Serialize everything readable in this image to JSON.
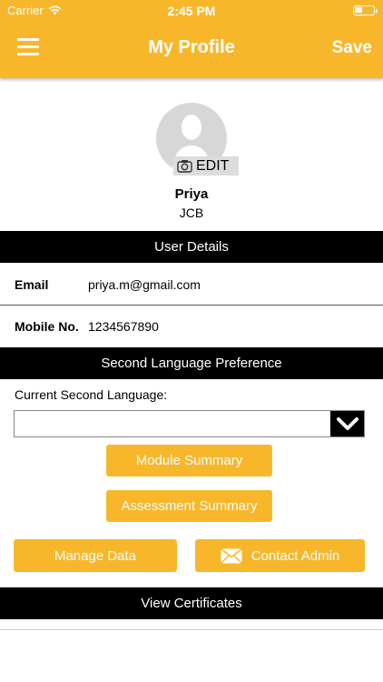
{
  "status_bar": {
    "carrier": "Carrier",
    "time": "2:45 PM"
  },
  "header": {
    "title": "My Profile",
    "save_label": "Save",
    "menu_icon": "hamburger-menu-icon"
  },
  "profile": {
    "edit_label": "EDIT",
    "name": "Priya",
    "organization": "JCB"
  },
  "user_details": {
    "title": "User Details",
    "email_label": "Email",
    "email_value": "priya.m@gmail.com",
    "mobile_label": "Mobile No.",
    "mobile_value": "1234567890"
  },
  "language": {
    "title": "Second Language Preference",
    "current_label": "Current Second Language:",
    "selected_value": ""
  },
  "buttons": {
    "module_summary": "Module Summary",
    "assessment_summary": "Assessment Summary",
    "manage_data": "Manage Data",
    "contact_admin": "Contact Admin"
  },
  "certificates": {
    "title": "View Certificates"
  },
  "colors": {
    "accent": "#f8b72b",
    "section_bar": "#000000"
  }
}
